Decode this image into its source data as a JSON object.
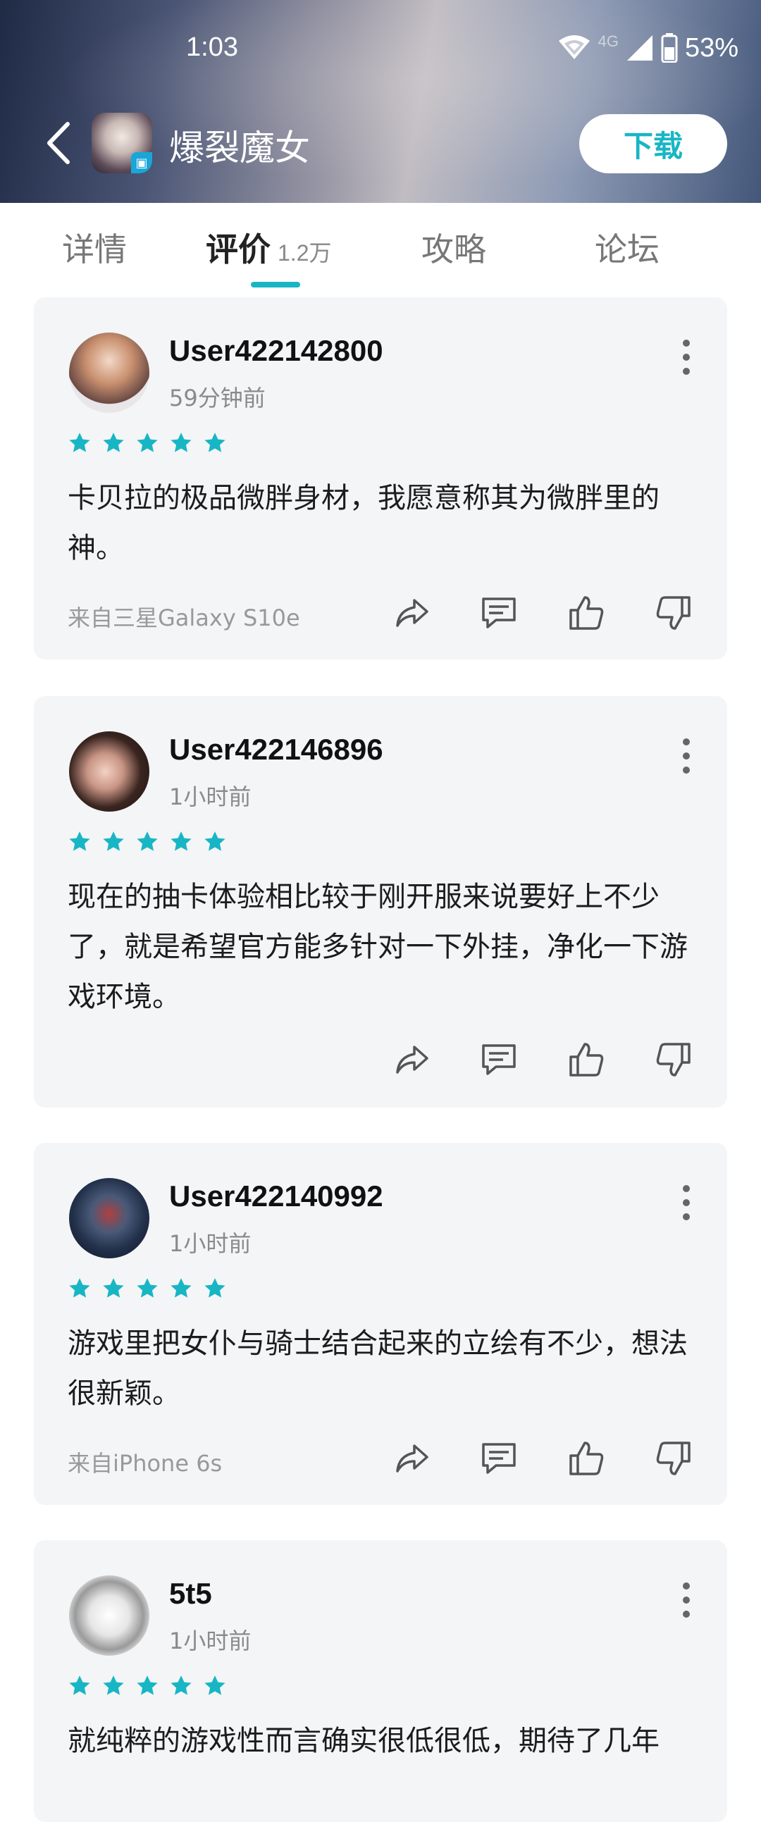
{
  "status": {
    "time": "1:03",
    "network": "4G",
    "battery": "53%"
  },
  "header": {
    "title": "爆裂魔女",
    "download_label": "下载"
  },
  "tabs": [
    {
      "label": "详情"
    },
    {
      "label": "评价",
      "count": "1.2万"
    },
    {
      "label": "攻略"
    },
    {
      "label": "论坛"
    }
  ],
  "reviews": [
    {
      "user": "User422142800",
      "time": "59分钟前",
      "stars": 5,
      "text": "卡贝拉的极品微胖身材，我愿意称其为微胖里的神。",
      "source": "来自三星Galaxy S10e"
    },
    {
      "user": "User422146896",
      "time": "1小时前",
      "stars": 5,
      "text": "现在的抽卡体验相比较于刚开服来说要好上不少了，就是希望官方能多针对一下外挂，净化一下游戏环境。",
      "source": ""
    },
    {
      "user": "User422140992",
      "time": "1小时前",
      "stars": 5,
      "text": "游戏里把女仆与骑士结合起来的立绘有不少，想法很新颖。",
      "source": "来自iPhone 6s"
    },
    {
      "user": "5t5",
      "time": "1小时前",
      "stars": 5,
      "text": "就纯粹的游戏性而言确实很低很低，期待了几年",
      "source": ""
    }
  ],
  "colors": {
    "accent": "#18b6c4",
    "card_bg": "#f4f5f7"
  }
}
